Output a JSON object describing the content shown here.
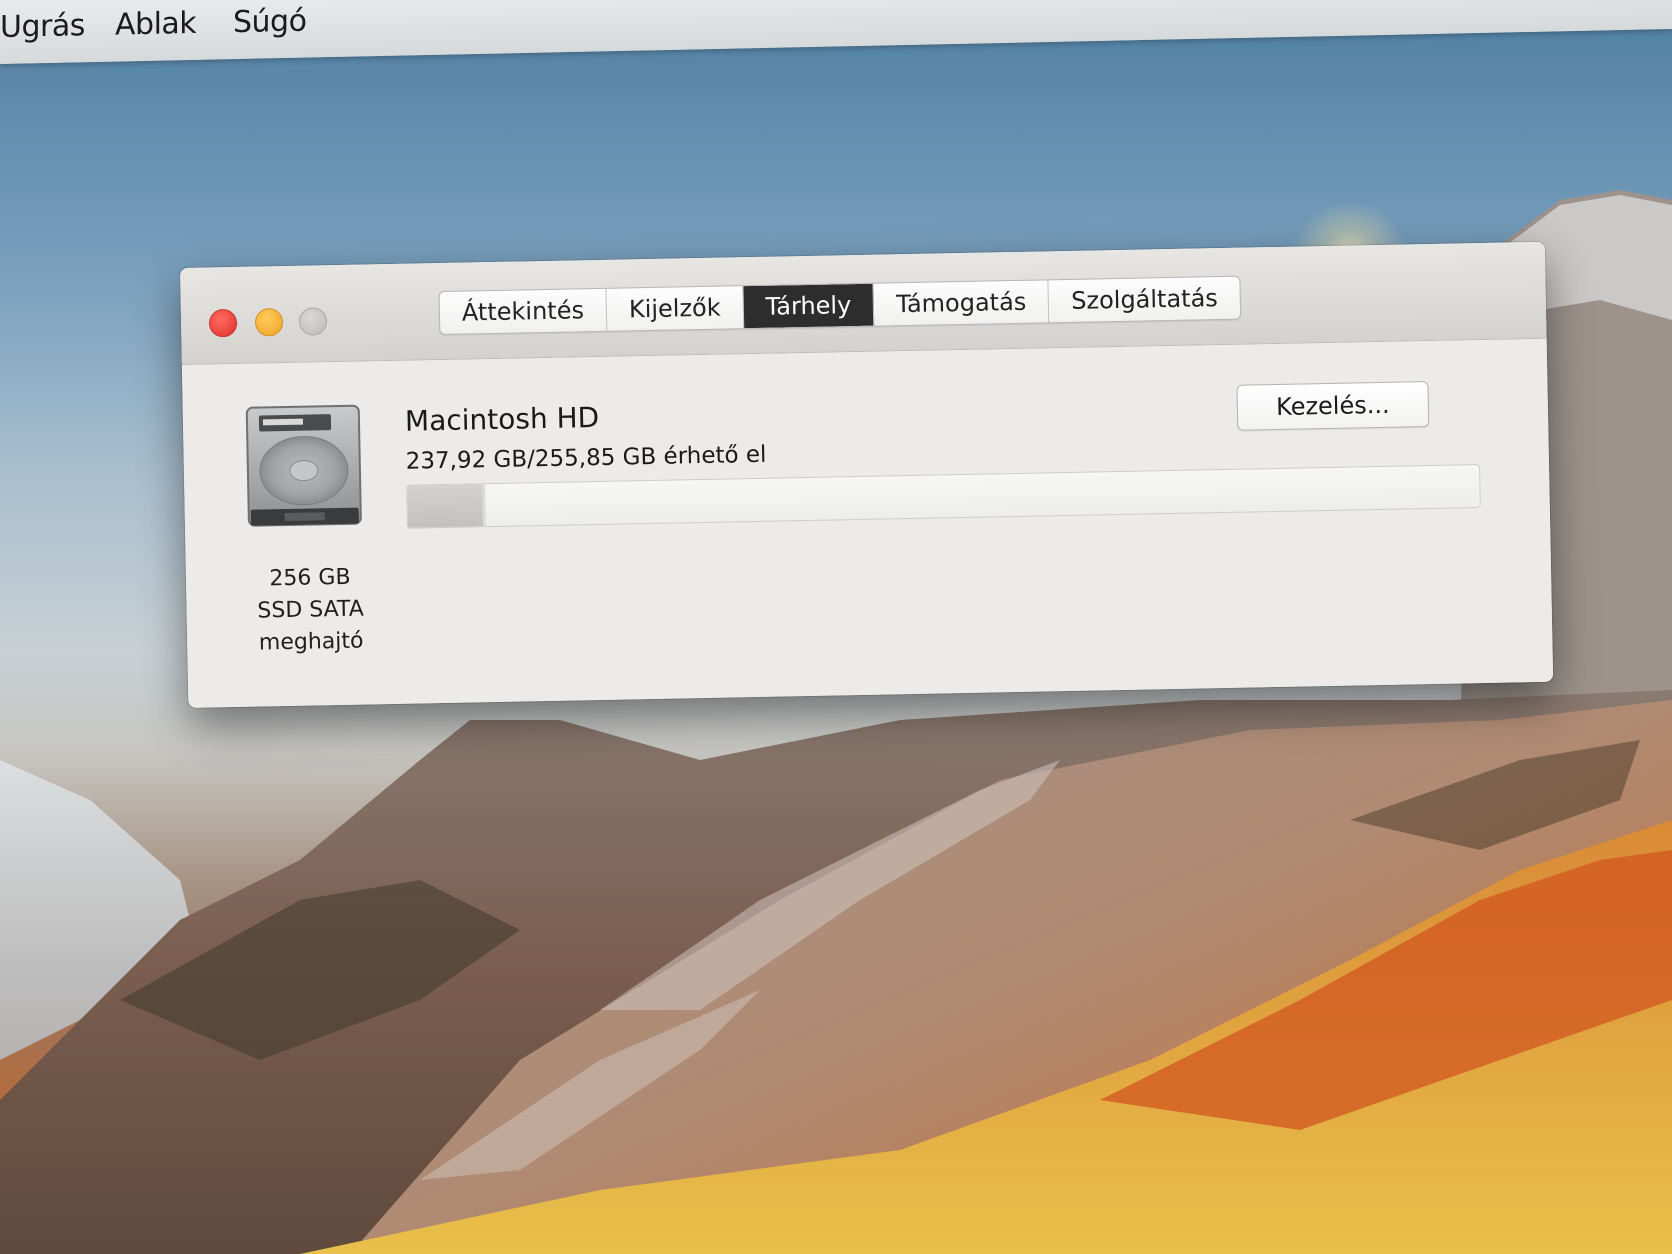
{
  "menubar": {
    "items": [
      "Ugrás",
      "Ablak",
      "Súgó"
    ]
  },
  "window": {
    "controls": [
      "close",
      "minimize",
      "zoom"
    ],
    "tabs": [
      {
        "label": "Áttekintés",
        "active": false
      },
      {
        "label": "Kijelzők",
        "active": false
      },
      {
        "label": "Tárhely",
        "active": true
      },
      {
        "label": "Támogatás",
        "active": false
      },
      {
        "label": "Szolgáltatás",
        "active": false
      }
    ]
  },
  "storage": {
    "disk_icon": "hard-drive-icon",
    "disk_caption": [
      "256 GB",
      "SSD SATA",
      "meghajtó"
    ],
    "disk_name": "Macintosh HD",
    "available_text": "237,92 GB/255,85 GB érhető el",
    "used_fraction": 0.07,
    "manage_label": "Kezelés..."
  },
  "colors": {
    "close": "#ec4b40",
    "minimize": "#f4b030",
    "zoom": "#c6c5c2",
    "active_tab": "#2d2d2d"
  }
}
